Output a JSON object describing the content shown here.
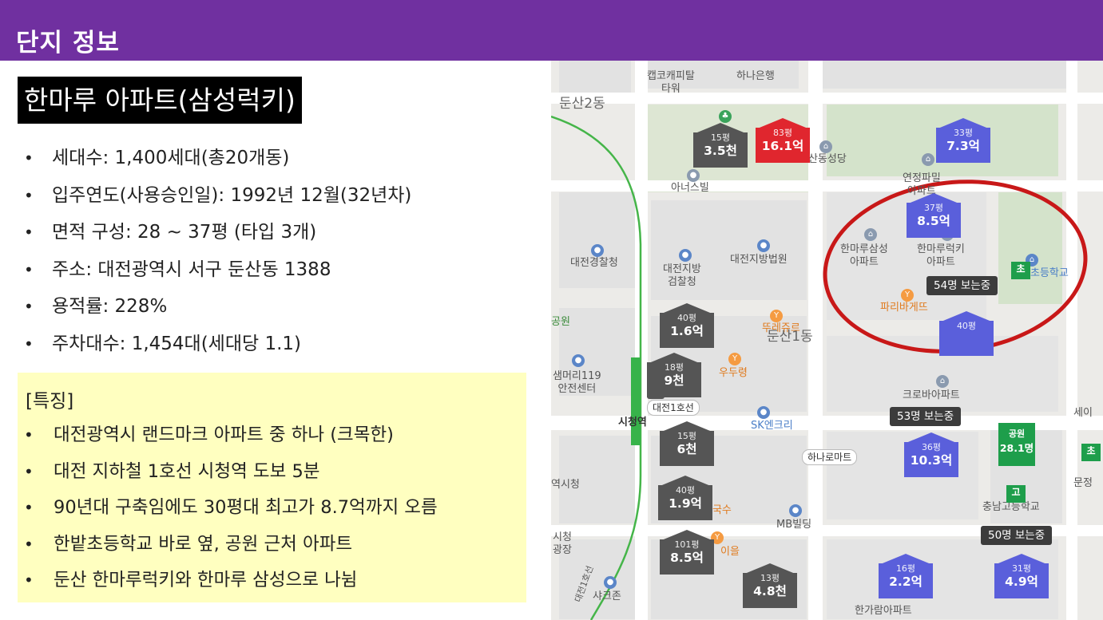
{
  "header": {
    "title": "단지 정보"
  },
  "apartment": {
    "name": "한마루 아파트(삼성럭키)",
    "info": [
      "세대수: 1,400세대(총20개동)",
      "입주연도(사용승인일): 1992년 12월(32년차)",
      "면적 구성: 28 ~ 37평 (타입 3개)",
      "주소: 대전광역시 서구 둔산동 1388",
      "용적률: 228%",
      "주차대수: 1,454대(세대당 1.1)"
    ]
  },
  "features": {
    "title": "[특징]",
    "items": [
      "대전광역시 랜드마크 아파트 중 하나 (크목한)",
      "대전 지하철 1호선 시청역 도보 5분",
      "90년대 구축임에도 30평대 최고가 8.7억까지 오름",
      "한밭초등학교 바로 옆, 공원 근처 아파트",
      "둔산 한마루럭키와 한마루 삼성으로 나뉨"
    ]
  },
  "map": {
    "labels": {
      "capital_tower": "캡코캐피탈\n타워",
      "hana_bank": "하나은행",
      "dunsan2": "둔산2동",
      "dunsan_church": "둔산동성당",
      "anuspil": "아너스빌",
      "yeonjeong": "연정파밀\n아파트",
      "police": "대전경찰청",
      "prosecutor": "대전지방\n검찰청",
      "court": "대전지방법원",
      "hanmaru_samsung": "한마루삼성\n아파트",
      "hanmaru_lucky": "한마루럭키\n아파트",
      "hanbat_school": "초등학교",
      "paris": "파리바게뜨",
      "park_left": "공원",
      "tourejour": "뚜레쥬르",
      "dunsan1": "둔산1동",
      "samsung_safety": "샘머리119\n안전센터",
      "udu": "우두령",
      "croba": "크로바아파트",
      "city_hall_station": "시청역",
      "line1_chip": "대전1호선",
      "sk": "SK엔크리",
      "hana_mart": "하나로마트",
      "city_hall": "역시청",
      "kalguksu": "칼국수",
      "mb": "MB빌딩",
      "chungnam_school": "충남고등학교",
      "city_plaza": "시청\n광장",
      "iyi": "이을",
      "shakzone": "샤크존",
      "hangaram": "한가람아파트",
      "subway_line": "대전1호선",
      "sei": "세이"
    },
    "tags": [
      {
        "size": "15평",
        "price": "3.5천",
        "color": "gray"
      },
      {
        "size": "83평",
        "price": "16.1억",
        "color": "red"
      },
      {
        "size": "33평",
        "price": "7.3억",
        "color": "blue"
      },
      {
        "size": "37평",
        "price": "8.5억",
        "color": "blue"
      },
      {
        "size": "40평",
        "price": "1.6억",
        "color": "gray"
      },
      {
        "size": "40평",
        "price": "",
        "color": "blue"
      },
      {
        "size": "18평",
        "price": "9천",
        "color": "gray"
      },
      {
        "size": "15평",
        "price": "6천",
        "color": "gray"
      },
      {
        "size": "36평",
        "price": "10.3억",
        "color": "blue"
      },
      {
        "size": "40평",
        "price": "1.9억",
        "color": "gray"
      },
      {
        "size": "101평",
        "price": "8.5억",
        "color": "gray"
      },
      {
        "size": "13평",
        "price": "4.8천",
        "color": "gray"
      },
      {
        "size": "16평",
        "price": "2.2억",
        "color": "blue"
      },
      {
        "size": "31평",
        "price": "4.9억",
        "color": "blue"
      }
    ],
    "viewers": [
      "54명 보는중",
      "53명 보는중",
      "50명 보는중"
    ],
    "park": {
      "label": "공원",
      "value": "28.1명"
    },
    "school_flag_1": "초",
    "school_flag_2": "고",
    "school_flag_3": "초",
    "right_edge": "문정"
  }
}
